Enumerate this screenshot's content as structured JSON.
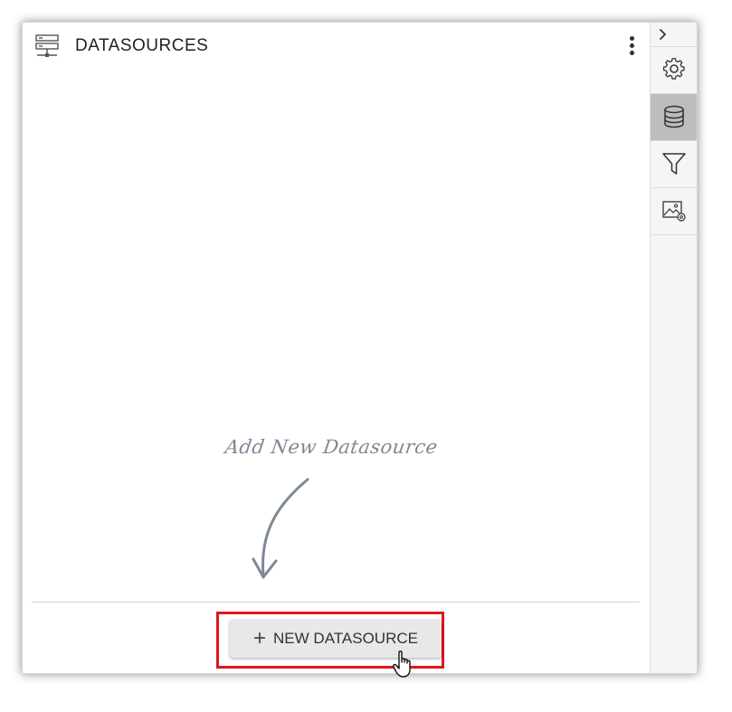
{
  "panel": {
    "title": "DATASOURCES",
    "header_icon": "server-icon",
    "menu_icon": "more-vertical-icon"
  },
  "empty_state": {
    "hint_text": "Add New Datasource",
    "arrow_icon": "curved-arrow-down-icon"
  },
  "actions": {
    "new_datasource_icon": "plus-icon",
    "new_datasource_label": "NEW DATASOURCE"
  },
  "toolbar": {
    "items": [
      {
        "name": "collapse",
        "icon": "chevron-right-icon",
        "active": false
      },
      {
        "name": "settings",
        "icon": "gear-icon",
        "active": false
      },
      {
        "name": "datasources",
        "icon": "database-icon",
        "active": true
      },
      {
        "name": "filter",
        "icon": "filter-icon",
        "active": false
      },
      {
        "name": "image-settings",
        "icon": "image-settings-icon",
        "active": false
      }
    ]
  },
  "colors": {
    "highlight": "#e3141e",
    "active_tool_bg": "#bdbdbd",
    "hint_text": "#7e8996",
    "button_bg": "#e8e8e8"
  }
}
